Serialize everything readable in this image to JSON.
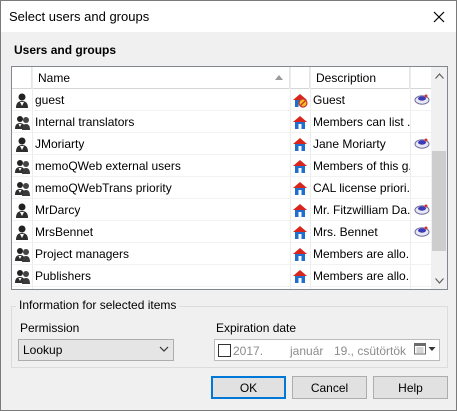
{
  "window": {
    "title": "Select users and groups"
  },
  "section": {
    "label": "Users and groups"
  },
  "grid": {
    "columns": {
      "name": "Name",
      "description": "Description"
    },
    "rows": [
      {
        "name": "guest",
        "icon": "single-user-icon",
        "group_icon": "blocked-house-icon",
        "description": "Guest",
        "has_chip": true
      },
      {
        "name": "Internal translators",
        "icon": "group-users-icon",
        "group_icon": "house-icon",
        "description": "Members can list ...",
        "has_chip": false
      },
      {
        "name": "JMoriarty",
        "icon": "single-user-icon",
        "group_icon": "house-icon",
        "description": "Jane Moriarty",
        "has_chip": true
      },
      {
        "name": "memoQWeb external users",
        "icon": "group-users-icon",
        "group_icon": "house-icon",
        "description": "Members of this g...",
        "has_chip": false
      },
      {
        "name": "memoQWebTrans priority",
        "icon": "group-users-icon",
        "group_icon": "house-icon",
        "description": "CAL license priori...",
        "has_chip": false
      },
      {
        "name": "MrDarcy",
        "icon": "single-user-icon",
        "group_icon": "house-icon",
        "description": "Mr. Fitzwilliam Da...",
        "has_chip": true
      },
      {
        "name": "MrsBennet",
        "icon": "single-user-icon",
        "group_icon": "house-icon",
        "description": "Mrs. Bennet",
        "has_chip": true
      },
      {
        "name": "Project managers",
        "icon": "group-users-icon",
        "group_icon": "house-icon",
        "description": "Members are allo...",
        "has_chip": false
      },
      {
        "name": "Publishers",
        "icon": "group-users-icon",
        "group_icon": "house-icon",
        "description": "Members are allo...",
        "has_chip": false
      }
    ]
  },
  "info": {
    "legend": "Information for selected items",
    "permission_label": "Permission",
    "permission_value": "Lookup",
    "expiration_label": "Expiration date",
    "date_year": "2017.",
    "date_month": "január",
    "date_day": "19., csütörtök",
    "expiration_enabled": false
  },
  "buttons": {
    "ok": "OK",
    "cancel": "Cancel",
    "help": "Help"
  },
  "colors": {
    "accent": "#0078d7",
    "house_red": "#d9251c",
    "house_blue": "#1f6fd0"
  }
}
